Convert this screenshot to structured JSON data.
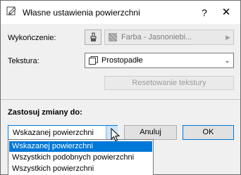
{
  "window": {
    "title": "Własne ustawienia powierzchni",
    "help_label": "?",
    "close_label": "✕"
  },
  "finish": {
    "label": "Wykończenie:",
    "value": "Farba - Jasnoniebi...",
    "disabled": true
  },
  "texture": {
    "label": "Tekstura:",
    "value": "Prostopadłe",
    "reset_label": "Resetowanie tekstury"
  },
  "apply": {
    "label": "Zastosuj zmiany do:",
    "selected": "Wskazanej powierzchni",
    "options": [
      "Wskazanej powierzchni",
      "Wszystkich podobnych powierzchni",
      "Wszystkich powierzchni"
    ],
    "highlighted_index": 0
  },
  "buttons": {
    "cancel_label": "Anuluj",
    "ok_label": "OK"
  },
  "colors": {
    "accent": "#0078d7",
    "background": "#f0f0f0"
  }
}
